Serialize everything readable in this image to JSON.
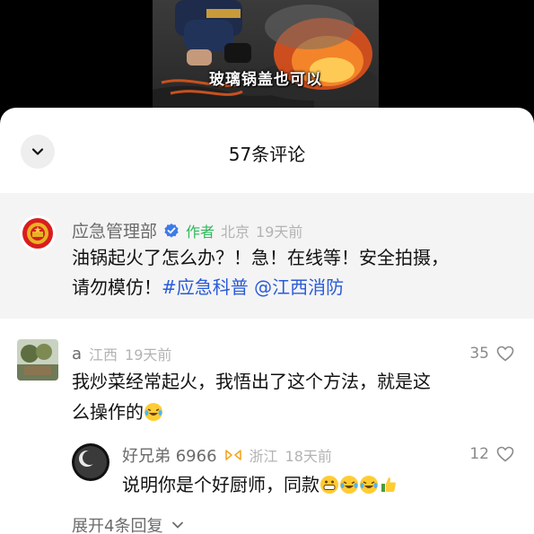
{
  "video": {
    "caption": "玻璃锅盖也可以"
  },
  "comments_panel": {
    "title": "57条评论",
    "collapse_icon": "chevron-down-icon"
  },
  "pinned_comment": {
    "author": "应急管理部",
    "verified_icon": "verified-badge-icon",
    "author_tag": "作者",
    "location": "北京",
    "time": "19天前",
    "text_line1": "油锅起火了怎么办？！急！在线等！安全拍摄，",
    "text_line2_plain": "请勿模仿！",
    "hashtag": "#应急科普",
    "mention": "@江西消防"
  },
  "comments": [
    {
      "user": "a",
      "location": "江西",
      "time": "19天前",
      "likes": "35",
      "text_line1": "我炒菜经常起火，我悟出了这个方法，就是这",
      "text_line2": "么操作的",
      "emoji_icon": "laughing-crying-emoji-icon"
    }
  ],
  "reply": {
    "user": "好兄弟 6966",
    "badge_icon": "fans-badge-icon",
    "location": "浙江",
    "time": "18天前",
    "likes": "12",
    "text": "说明你是个好厨师，同款",
    "emoji_icons": [
      "grinning-emoji-icon",
      "laughing-crying-emoji-icon",
      "laughing-crying-emoji-icon",
      "thumbs-up-emoji-icon"
    ]
  },
  "expand_replies": {
    "label": "展开4条回复"
  },
  "colors": {
    "author_tag": "#2fb85b",
    "link": "#2a5bd7",
    "verified": "#3d7be8",
    "badge": "#f5a623"
  }
}
